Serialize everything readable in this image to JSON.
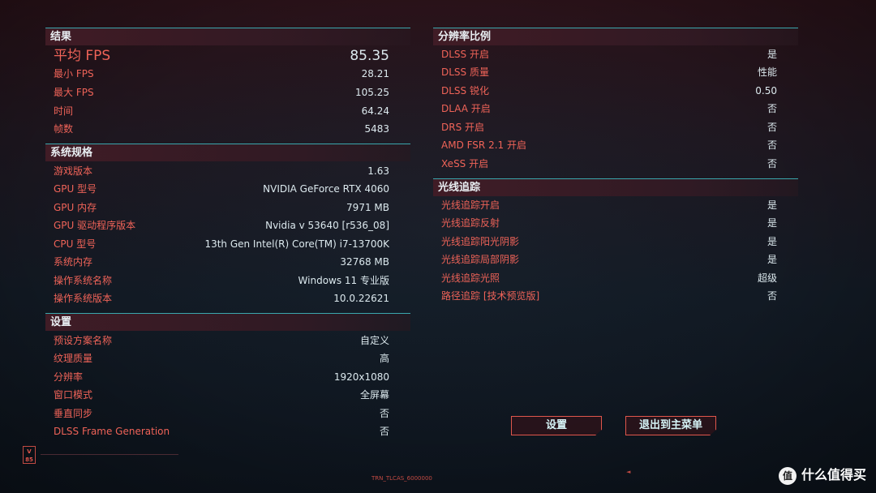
{
  "results": {
    "title": "结果",
    "rows": [
      {
        "label": "平均 FPS",
        "value": "85.35"
      },
      {
        "label": "最小 FPS",
        "value": "28.21"
      },
      {
        "label": "最大 FPS",
        "value": "105.25"
      },
      {
        "label": "时间",
        "value": "64.24"
      },
      {
        "label": "帧数",
        "value": "5483"
      }
    ]
  },
  "system": {
    "title": "系统规格",
    "rows": [
      {
        "label": "游戏版本",
        "value": "1.63"
      },
      {
        "label": "GPU 型号",
        "value": "NVIDIA GeForce RTX 4060"
      },
      {
        "label": "GPU 内存",
        "value": "7971 MB"
      },
      {
        "label": "GPU 驱动程序版本",
        "value": "Nvidia v 53640 [r536_08]"
      },
      {
        "label": "CPU 型号",
        "value": "13th Gen Intel(R) Core(TM) i7-13700K"
      },
      {
        "label": "系统内存",
        "value": "32768 MB"
      },
      {
        "label": "操作系统名称",
        "value": "Windows 11 专业版"
      },
      {
        "label": "操作系统版本",
        "value": "10.0.22621"
      }
    ]
  },
  "settings": {
    "title": "设置",
    "rows": [
      {
        "label": "预设方案名称",
        "value": "自定义"
      },
      {
        "label": "纹理质量",
        "value": "高"
      },
      {
        "label": "分辨率",
        "value": "1920x1080"
      },
      {
        "label": "窗口模式",
        "value": "全屏幕"
      },
      {
        "label": "垂直同步",
        "value": "否"
      },
      {
        "label": "DLSS Frame Generation",
        "value": "否"
      }
    ]
  },
  "scaling": {
    "title": "分辨率比例",
    "rows": [
      {
        "label": "DLSS 开启",
        "value": "是"
      },
      {
        "label": "DLSS 质量",
        "value": "性能"
      },
      {
        "label": "DLSS 锐化",
        "value": "0.50"
      },
      {
        "label": "DLAA 开启",
        "value": "否"
      },
      {
        "label": "DRS 开启",
        "value": "否"
      },
      {
        "label": "AMD FSR 2.1 开启",
        "value": "否"
      },
      {
        "label": "XeSS 开启",
        "value": "否"
      }
    ]
  },
  "raytracing": {
    "title": "光线追踪",
    "rows": [
      {
        "label": "光线追踪开启",
        "value": "是"
      },
      {
        "label": "光线追踪反射",
        "value": "是"
      },
      {
        "label": "光线追踪阳光阴影",
        "value": "是"
      },
      {
        "label": "光线追踪局部阴影",
        "value": "是"
      },
      {
        "label": "光线追踪光照",
        "value": "超级"
      },
      {
        "label": "路径追踪 [技术预览版]",
        "value": "否"
      }
    ]
  },
  "buttons": {
    "settings": "设置",
    "exit": "退出到主菜单"
  },
  "badge": {
    "line1": "V",
    "line2": "85"
  },
  "footer_mark": "TRN_TLCAS_6000000",
  "watermark": {
    "logo": "值",
    "text": "什么值得买"
  },
  "colors": {
    "label_red": "#ef6358",
    "value_white": "#dce9ee",
    "accent_cyan": "#3aa7ad",
    "header_bg": "#421c26"
  }
}
